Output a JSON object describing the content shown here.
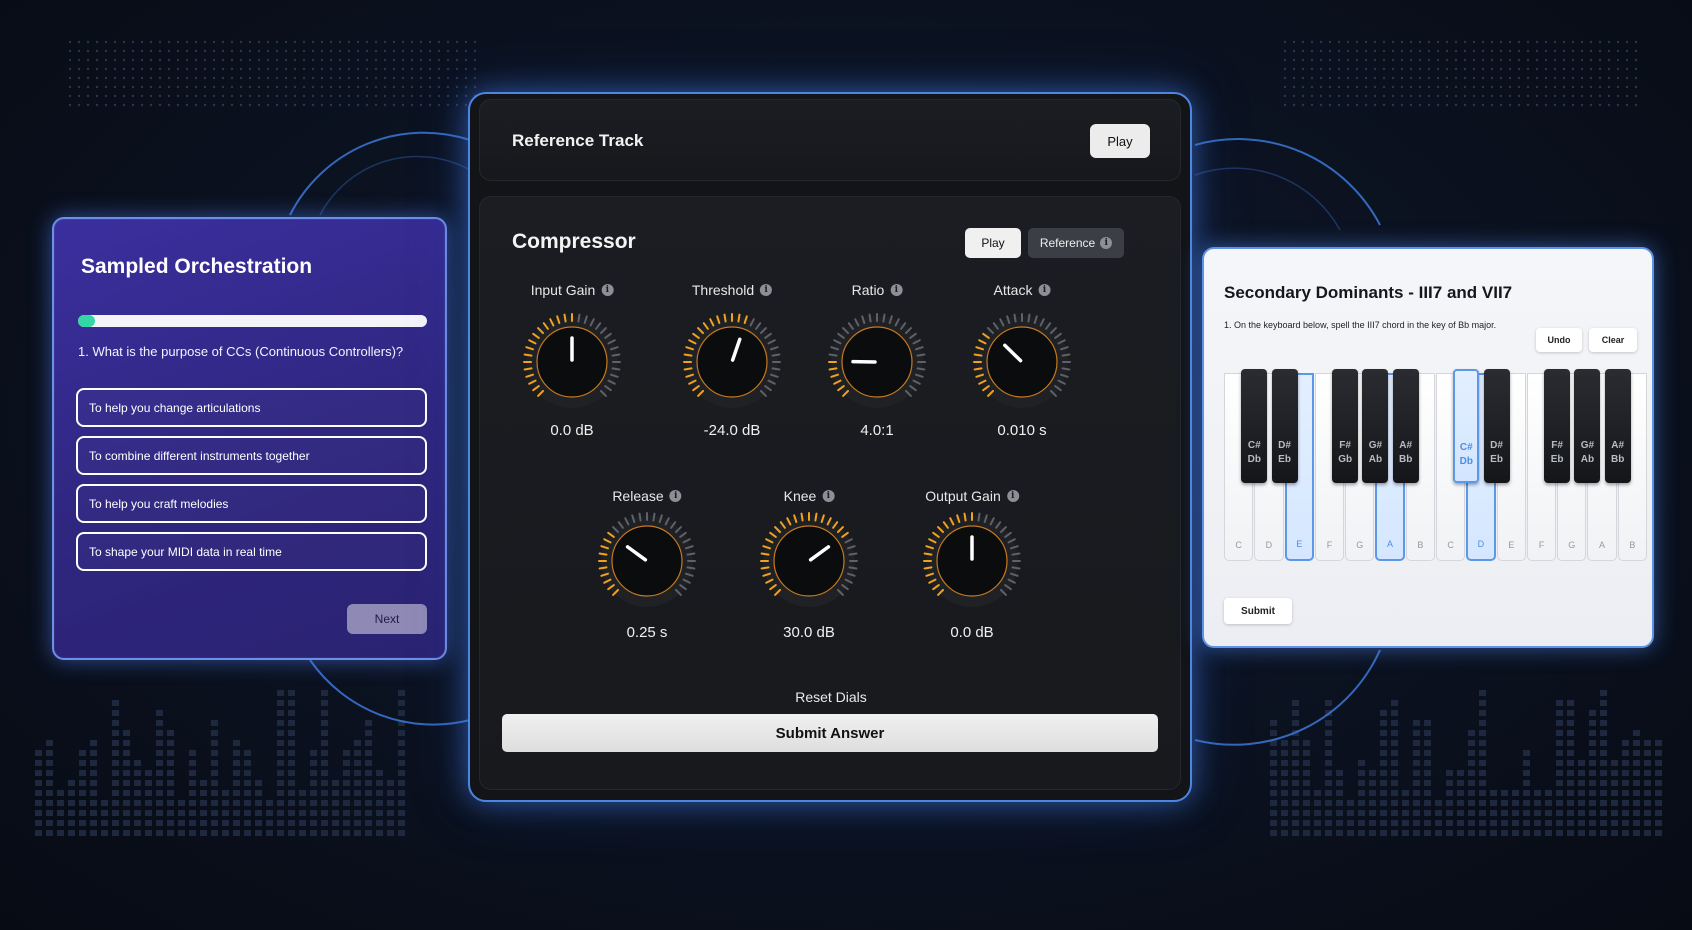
{
  "quiz": {
    "title": "Sampled Orchestration",
    "progress": 0.05,
    "question": "1. What is the purpose of CCs (Continuous Controllers)?",
    "options": [
      "To help you change articulations",
      "To combine different instruments together",
      "To help you craft melodies",
      "To shape your MIDI data in real time"
    ],
    "next_label": "Next"
  },
  "reference": {
    "title": "Reference Track",
    "play_label": "Play"
  },
  "compressor": {
    "title": "Compressor",
    "play_label": "Play",
    "reference_label": "Reference",
    "info_glyph": "i",
    "knobs": [
      {
        "label": "Input Gain",
        "value": "0.0 dB",
        "level": 0.5
      },
      {
        "label": "Threshold",
        "value": "-24.0 dB",
        "level": 0.57
      },
      {
        "label": "Ratio",
        "value": "4.0:1",
        "level": 0.17
      },
      {
        "label": "Attack",
        "value": "0.010 s",
        "level": 0.33
      },
      {
        "label": "Release",
        "value": "0.25 s",
        "level": 0.3
      },
      {
        "label": "Knee",
        "value": "30.0 dB",
        "level": 0.7
      },
      {
        "label": "Output Gain",
        "value": "0.0 dB",
        "level": 0.5
      }
    ],
    "reset_label": "Reset Dials",
    "submit_label": "Submit Answer",
    "colors": {
      "active_tick": "#f0a21e",
      "inactive_tick": "#5e6168",
      "ring": "#c77a1e"
    }
  },
  "piano": {
    "title": "Secondary Dominants - III7 and VII7",
    "instruction": "1. On the keyboard below, spell the III7 chord in the key of Bb major.",
    "undo_label": "Undo",
    "clear_label": "Clear",
    "submit_label": "Submit",
    "white_keys": [
      {
        "note": "C",
        "selected": false
      },
      {
        "note": "D",
        "selected": false
      },
      {
        "note": "E",
        "selected": true
      },
      {
        "note": "F",
        "selected": false
      },
      {
        "note": "G",
        "selected": false
      },
      {
        "note": "A",
        "selected": true
      },
      {
        "note": "B",
        "selected": false
      },
      {
        "note": "C",
        "selected": false
      },
      {
        "note": "D",
        "selected": true
      },
      {
        "note": "E",
        "selected": false
      },
      {
        "note": "F",
        "selected": false
      },
      {
        "note": "G",
        "selected": false
      },
      {
        "note": "A",
        "selected": false
      },
      {
        "note": "B",
        "selected": false
      }
    ],
    "black_keys": [
      {
        "note": "C#\nDb",
        "selected": false
      },
      {
        "note": "D#\nEb",
        "selected": false
      },
      {
        "note": "F#\nGb",
        "selected": false
      },
      {
        "note": "G#\nAb",
        "selected": false
      },
      {
        "note": "A#\nBb",
        "selected": false
      },
      {
        "note": "C#\nDb",
        "selected": true
      },
      {
        "note": "D#\nEb",
        "selected": false
      },
      {
        "note": "F#\nEb",
        "selected": false
      },
      {
        "note": "G#\nAb",
        "selected": false
      },
      {
        "note": "A#\nBb",
        "selected": false
      }
    ],
    "accent_color": "#5c97e8"
  }
}
